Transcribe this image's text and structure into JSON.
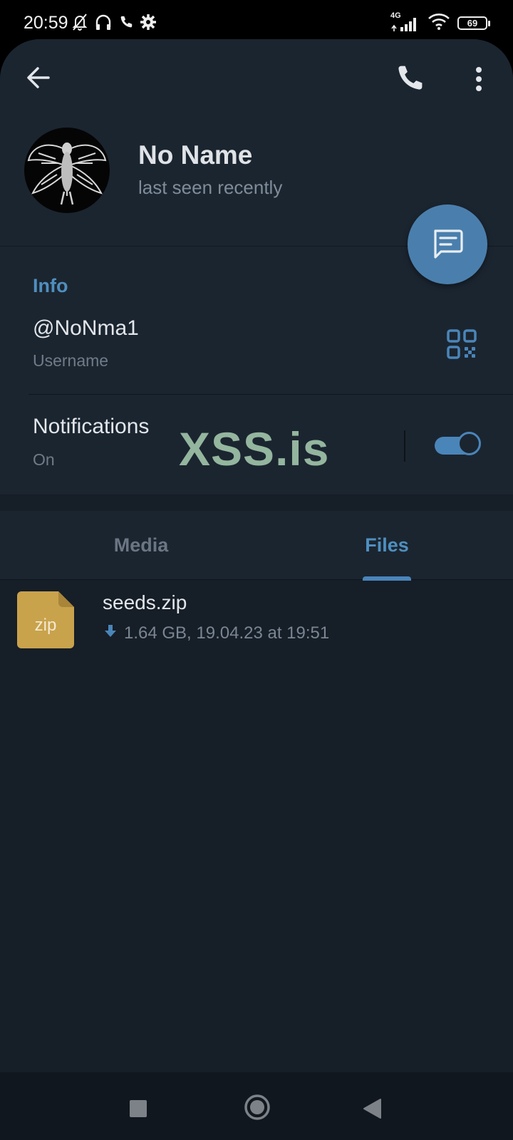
{
  "status_bar": {
    "time": "20:59",
    "network_type": "4G",
    "battery": "69"
  },
  "header": {
    "name": "No Name",
    "status": "last seen recently"
  },
  "info": {
    "section_title": "Info",
    "username": "@NoNma1",
    "username_label": "Username",
    "notifications_label": "Notifications",
    "notifications_value": "On",
    "watermark": "XSS.is"
  },
  "tabs": {
    "media": "Media",
    "files": "Files"
  },
  "files": [
    {
      "extension": "zip",
      "name": "seeds.zip",
      "meta": "1.64 GB, 19.04.23 at 19:51"
    }
  ],
  "colors": {
    "accent": "#4f8fbf",
    "background": "#161e27",
    "panel": "#1b2530",
    "file_icon": "#c9a24c"
  },
  "icons": {
    "back": "arrow-left-icon",
    "call": "phone-icon",
    "more": "more-vertical-icon",
    "qr": "qr-code-icon",
    "message": "message-icon",
    "download": "download-icon"
  }
}
